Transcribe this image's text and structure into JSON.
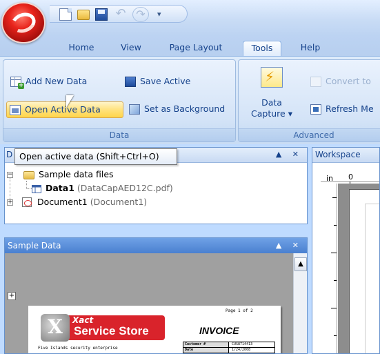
{
  "quick_access": {
    "icons": [
      "new-document-icon",
      "open-folder-icon",
      "save-icon",
      "undo-icon",
      "redo-icon",
      "customize-dropdown-icon"
    ],
    "more_label": "▾"
  },
  "tabs": [
    {
      "label": "Home"
    },
    {
      "label": "View"
    },
    {
      "label": "Page Layout"
    },
    {
      "label": "Tools",
      "active": true
    },
    {
      "label": "Help"
    }
  ],
  "ribbon": {
    "data_group": {
      "title": "Data",
      "add_new": "Add New Data",
      "save_active": "Save Active",
      "open_active": "Open Active Data",
      "set_background": "Set as Background"
    },
    "advanced_group": {
      "title": "Advanced",
      "data_capture_1": "Data",
      "data_capture_2": "Capture ▾",
      "convert": "Convert to",
      "refresh": "Refresh Me"
    }
  },
  "tooltip": "Open active data (Shift+Ctrl+O)",
  "doc_pane": {
    "header_prefix": "D",
    "controls": "▲ ✕",
    "tree": {
      "sample_files": "Sample data files",
      "data1_name": "Data1",
      "data1_file": "(DataCapAED12C.pdf)",
      "document1_name": "Document1",
      "document1_detail": "(Document1)"
    }
  },
  "sample_pane": {
    "title": "Sample Data",
    "controls": "▲ ✕",
    "invoice": {
      "page": "Page 1 of 2",
      "title": "INVOICE",
      "logo_top": "Xact",
      "logo_main": "Service Store",
      "tagline": "Five Islands security enterprise",
      "rows": [
        {
          "k": "Customer #",
          "v": "CUS8714413"
        },
        {
          "k": "Date",
          "v": "1/24/2008"
        }
      ]
    }
  },
  "workspace": {
    "title": "Workspace",
    "ruler_unit": "in",
    "ruler_zero": "0"
  },
  "colors": {
    "ribbon_bg": "#bfdbff",
    "accent_blue": "#15428b",
    "highlight": "#ffd54a",
    "invoice_red": "#d9232b"
  }
}
